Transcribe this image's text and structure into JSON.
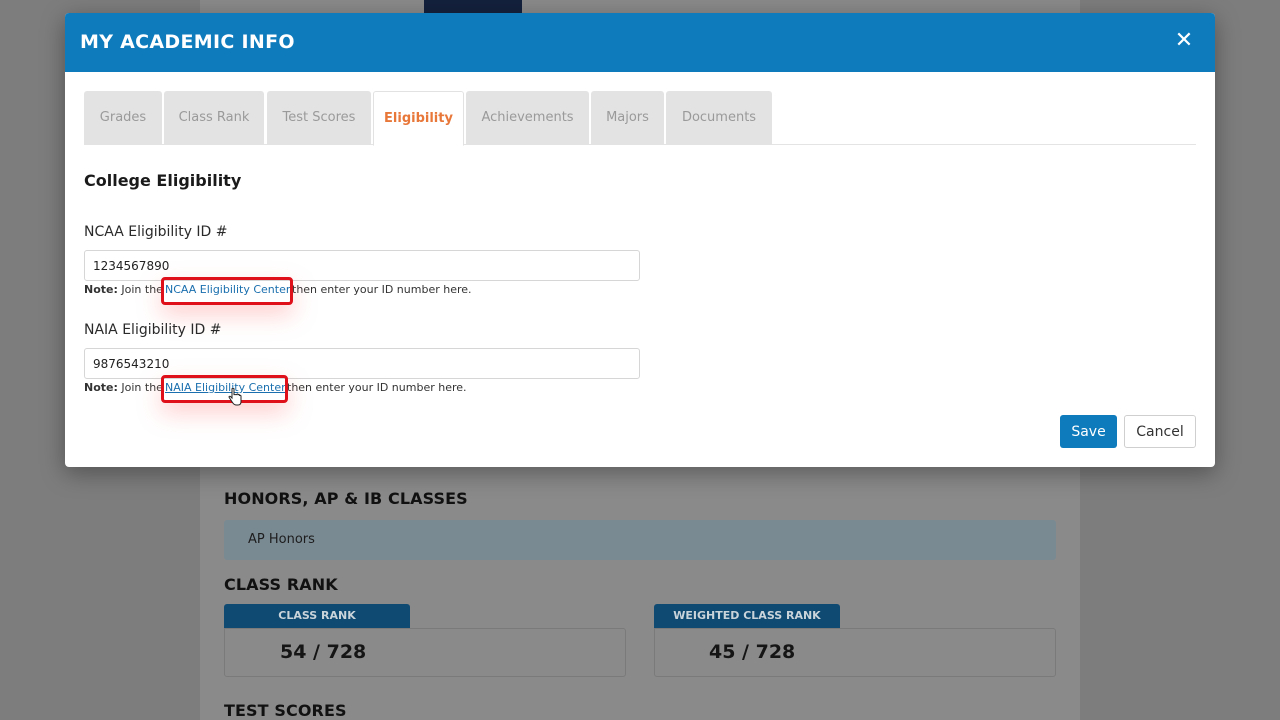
{
  "background": {
    "honors_title": "HONORS, AP & IB CLASSES",
    "honors_value": "AP Honors",
    "class_rank_title": "CLASS RANK",
    "class_rank_label": "CLASS RANK",
    "class_rank_value": "54 / 728",
    "weighted_rank_label": "WEIGHTED CLASS RANK",
    "weighted_rank_value": "45 / 728",
    "test_scores_title": "TEST SCORES"
  },
  "modal": {
    "title": "MY ACADEMIC INFO",
    "close_glyph": "✕",
    "tabs": [
      {
        "label": "Grades"
      },
      {
        "label": "Class Rank"
      },
      {
        "label": "Test Scores"
      },
      {
        "label": "Eligibility"
      },
      {
        "label": "Achievements"
      },
      {
        "label": "Majors"
      },
      {
        "label": "Documents"
      }
    ],
    "active_tab": "Eligibility",
    "section_heading": "College Eligibility",
    "ncaa": {
      "label": "NCAA Eligibility ID #",
      "value": "1234567890",
      "note_prefix": "Note:",
      "note_before": "Join the",
      "link_text": "NCAA Eligibility Center",
      "note_after": "then enter your ID number here."
    },
    "naia": {
      "label": "NAIA Eligibility ID #",
      "value": "9876543210",
      "note_prefix": "Note:",
      "note_before": "Join the",
      "link_text": "NAIA Eligibility Center",
      "note_after": "then enter your ID number here."
    },
    "save_label": "Save",
    "cancel_label": "Cancel"
  },
  "colors": {
    "header_blue": "#0e7bbd",
    "active_tab_orange": "#e8773a",
    "highlight_red": "#e0101a",
    "link_blue": "#1a6fae"
  }
}
